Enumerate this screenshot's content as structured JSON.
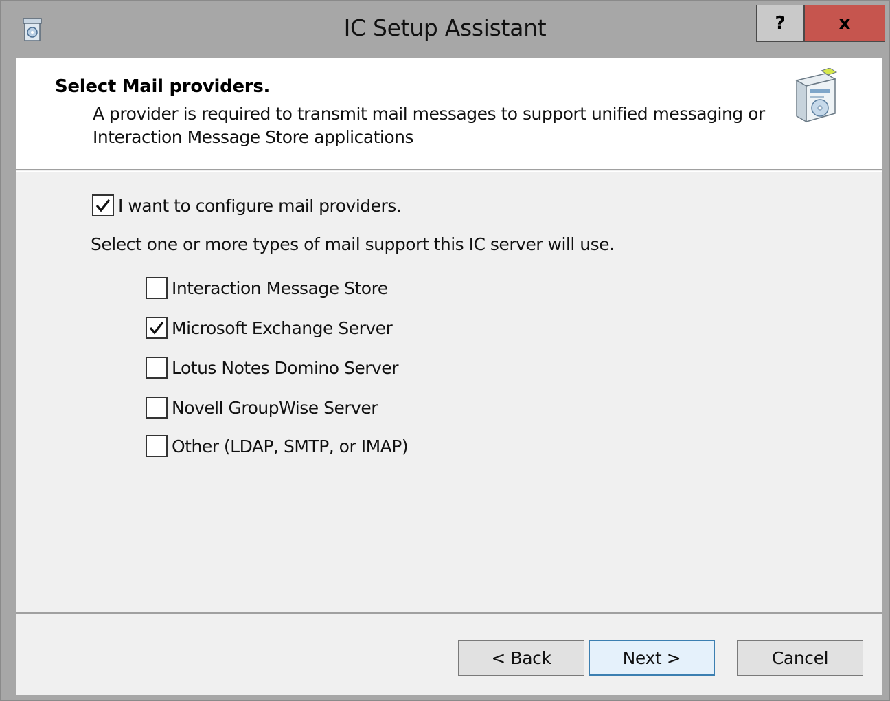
{
  "window": {
    "title": "IC Setup Assistant",
    "help_label": "?",
    "close_label": "x"
  },
  "header": {
    "title": "Select Mail providers.",
    "description_line1": "A provider is required to transmit mail messages to support unified messaging or",
    "description_line2": "Interaction Message Store applications"
  },
  "configure": {
    "label": "I want to configure mail providers.",
    "checked": true
  },
  "instruction": "Select one or more types of mail support this IC server will use.",
  "providers": [
    {
      "label": "Interaction Message Store",
      "checked": false
    },
    {
      "label": "Microsoft Exchange Server",
      "checked": true
    },
    {
      "label": "Lotus Notes Domino Server",
      "checked": false
    },
    {
      "label": "Novell GroupWise Server",
      "checked": false
    },
    {
      "label": "Other (LDAP, SMTP, or IMAP)",
      "checked": false
    }
  ],
  "buttons": {
    "back": "< Back",
    "next": "Next >",
    "cancel": "Cancel"
  },
  "colors": {
    "titlebar": "#a7a7a7",
    "close_button": "#c6554e",
    "default_button_border": "#3c7fb1"
  },
  "icons": {
    "app": "setup-box-icon",
    "header": "software-box-cd-icon",
    "check": "checkmark-icon"
  }
}
